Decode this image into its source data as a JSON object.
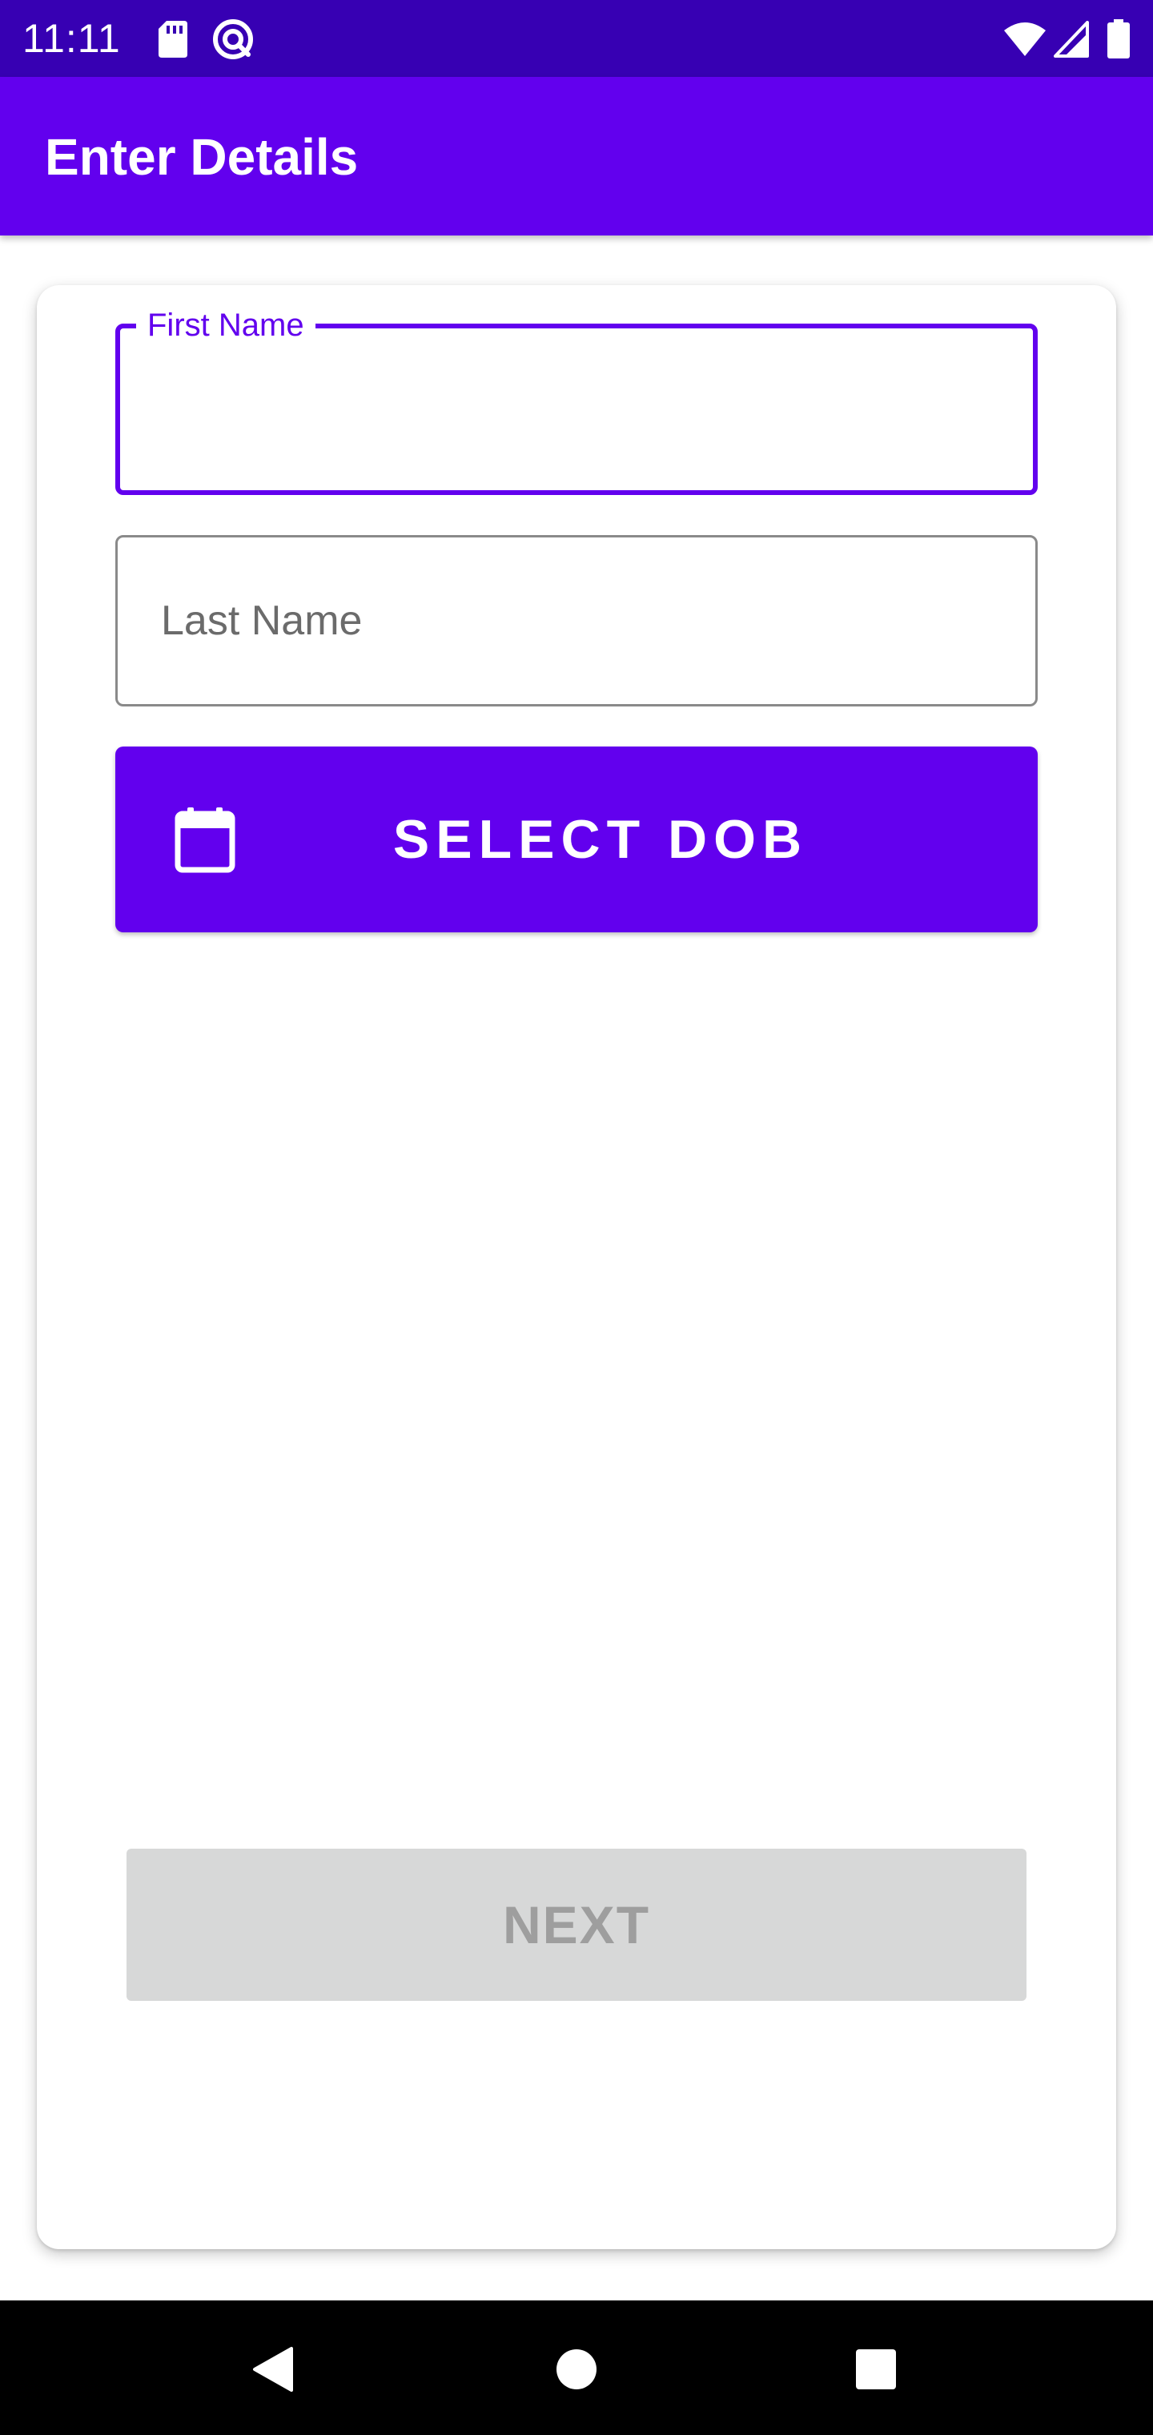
{
  "status_bar": {
    "time": "11:11",
    "icons": [
      "sd-card-icon",
      "sync-icon",
      "wifi-icon",
      "cell-signal-icon",
      "battery-icon"
    ]
  },
  "app_bar": {
    "title": "Enter Details"
  },
  "form": {
    "first_name": {
      "label": "First Name",
      "value": "",
      "focused": true
    },
    "last_name": {
      "placeholder": "Last Name",
      "value": ""
    },
    "dob_button": {
      "label": "SELECT DOB",
      "icon": "calendar-icon"
    },
    "next_button": {
      "label": "NEXT",
      "enabled": false
    }
  },
  "nav_bar": {
    "icons": [
      "back-icon",
      "home-icon",
      "recents-icon"
    ]
  },
  "colors": {
    "primary": "#6200ee",
    "primary_dark": "#3700b3",
    "disabled_bg": "#d7d8d8",
    "disabled_text": "#9e9e9e"
  }
}
